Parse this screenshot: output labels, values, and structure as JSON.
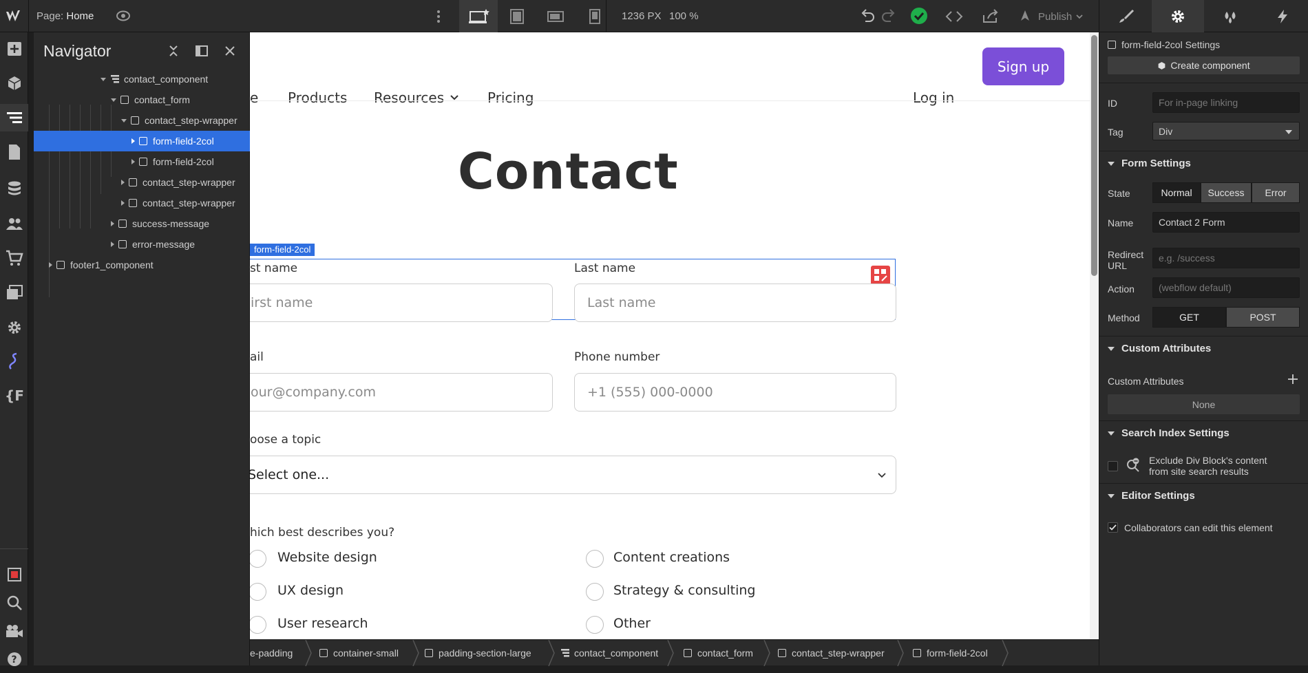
{
  "topbar": {
    "page_label": "Page:",
    "page_name": "Home",
    "width_value": "1236 PX",
    "zoom_value": "100 %",
    "publish_label": "Publish",
    "accent": "#4353ff",
    "success_color": "#1fae4b"
  },
  "leftbar": {
    "items": [
      "add-icon",
      "cube-icon",
      "navigator-icon",
      "pages-icon",
      "cms-icon",
      "users-icon",
      "ecommerce-icon",
      "assets-icon",
      "settings-icon",
      "interactions-icon",
      "variables-icon",
      "record-icon",
      "search-icon",
      "video-icon",
      "help-icon"
    ]
  },
  "navigator": {
    "title": "Navigator",
    "rows": [
      {
        "label": "contact_component",
        "caret": "down",
        "icon": "component"
      },
      {
        "label": "contact_form",
        "caret": "down",
        "icon": "box"
      },
      {
        "label": "contact_step-wrapper",
        "caret": "down",
        "icon": "box"
      },
      {
        "label": "form-field-2col",
        "caret": "right",
        "icon": "box",
        "selected": true
      },
      {
        "label": "form-field-2col",
        "caret": "right",
        "icon": "box"
      },
      {
        "label": "contact_step-wrapper",
        "caret": "right",
        "icon": "box"
      },
      {
        "label": "contact_step-wrapper",
        "caret": "right",
        "icon": "box"
      },
      {
        "label": "success-message",
        "caret": "right",
        "icon": "box"
      },
      {
        "label": "error-message",
        "caret": "right",
        "icon": "box"
      },
      {
        "label": "footer1_component",
        "caret": "right",
        "icon": "box"
      }
    ]
  },
  "canvas": {
    "nav_links": [
      "e",
      "Products",
      "Resources",
      "Pricing"
    ],
    "login": "Log in",
    "signup": "Sign up",
    "signup_color": "#7b4fd8",
    "heading": "Contact",
    "selected_tag": "form-field-2col",
    "first_name_label": "st name",
    "first_name_placeholder": "irst name",
    "last_name_label": "Last name",
    "last_name_placeholder": "Last name",
    "email_label": "ail",
    "email_placeholder": "our@company.com",
    "phone_label": "Phone number",
    "phone_placeholder": "+1 (555) 000-0000",
    "topic_label": "oose a topic",
    "topic_value": "Select one...",
    "describe_label": "hich best describes you?",
    "radios_left": [
      "Website design",
      "UX design",
      "User research"
    ],
    "radios_right": [
      "Content creations",
      "Strategy & consulting",
      "Other"
    ]
  },
  "breadcrumb": [
    "e-padding",
    "container-small",
    "padding-section-large",
    "contact_component",
    "contact_form",
    "contact_step-wrapper",
    "form-field-2col"
  ],
  "rightpanel": {
    "tabs": [
      "brush-icon",
      "gear-icon",
      "drops-icon",
      "bolt-icon"
    ],
    "settings_title": "form-field-2col Settings",
    "create_component": "Create component",
    "id_label": "ID",
    "id_placeholder": "For in-page linking",
    "tag_label": "Tag",
    "tag_value": "Div",
    "form_settings": "Form Settings",
    "state_label": "State",
    "states": [
      "Normal",
      "Success",
      "Error"
    ],
    "name_label": "Name",
    "name_value": "Contact 2 Form",
    "redirect_label_1": "Redirect",
    "redirect_label_2": "URL",
    "redirect_placeholder": "e.g. /success",
    "action_label": "Action",
    "action_placeholder": "(webflow default)",
    "method_label": "Method",
    "methods": [
      "GET",
      "POST"
    ],
    "custom_attributes_section": "Custom Attributes",
    "custom_attributes_label": "Custom Attributes",
    "none_label": "None",
    "search_index_section": "Search Index Settings",
    "exclude_line_1": "Exclude Div Block's content",
    "exclude_line_2": "from site search results",
    "editor_section": "Editor Settings",
    "collaborators_label": "Collaborators can edit this element"
  }
}
